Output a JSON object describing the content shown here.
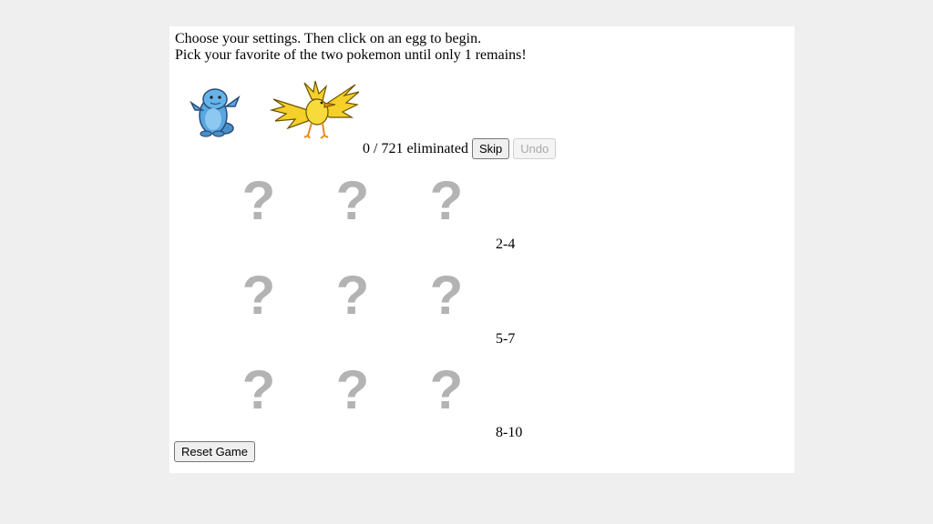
{
  "instructions": {
    "line1": "Choose your settings. Then click on an egg to begin.",
    "line2": "Pick your favorite of the two pokemon until only 1 remains!"
  },
  "status": {
    "eliminated_text": "0 / 721 eliminated"
  },
  "controls": {
    "skip_label": "Skip",
    "undo_label": "Undo",
    "reset_label": "Reset Game"
  },
  "egg_symbol": "?",
  "egg_rows": [
    {
      "label": "2-4"
    },
    {
      "label": "5-7"
    },
    {
      "label": "8-10"
    }
  ],
  "colors": {
    "egg": "#b3b3b3",
    "page_background": "#efefef"
  }
}
